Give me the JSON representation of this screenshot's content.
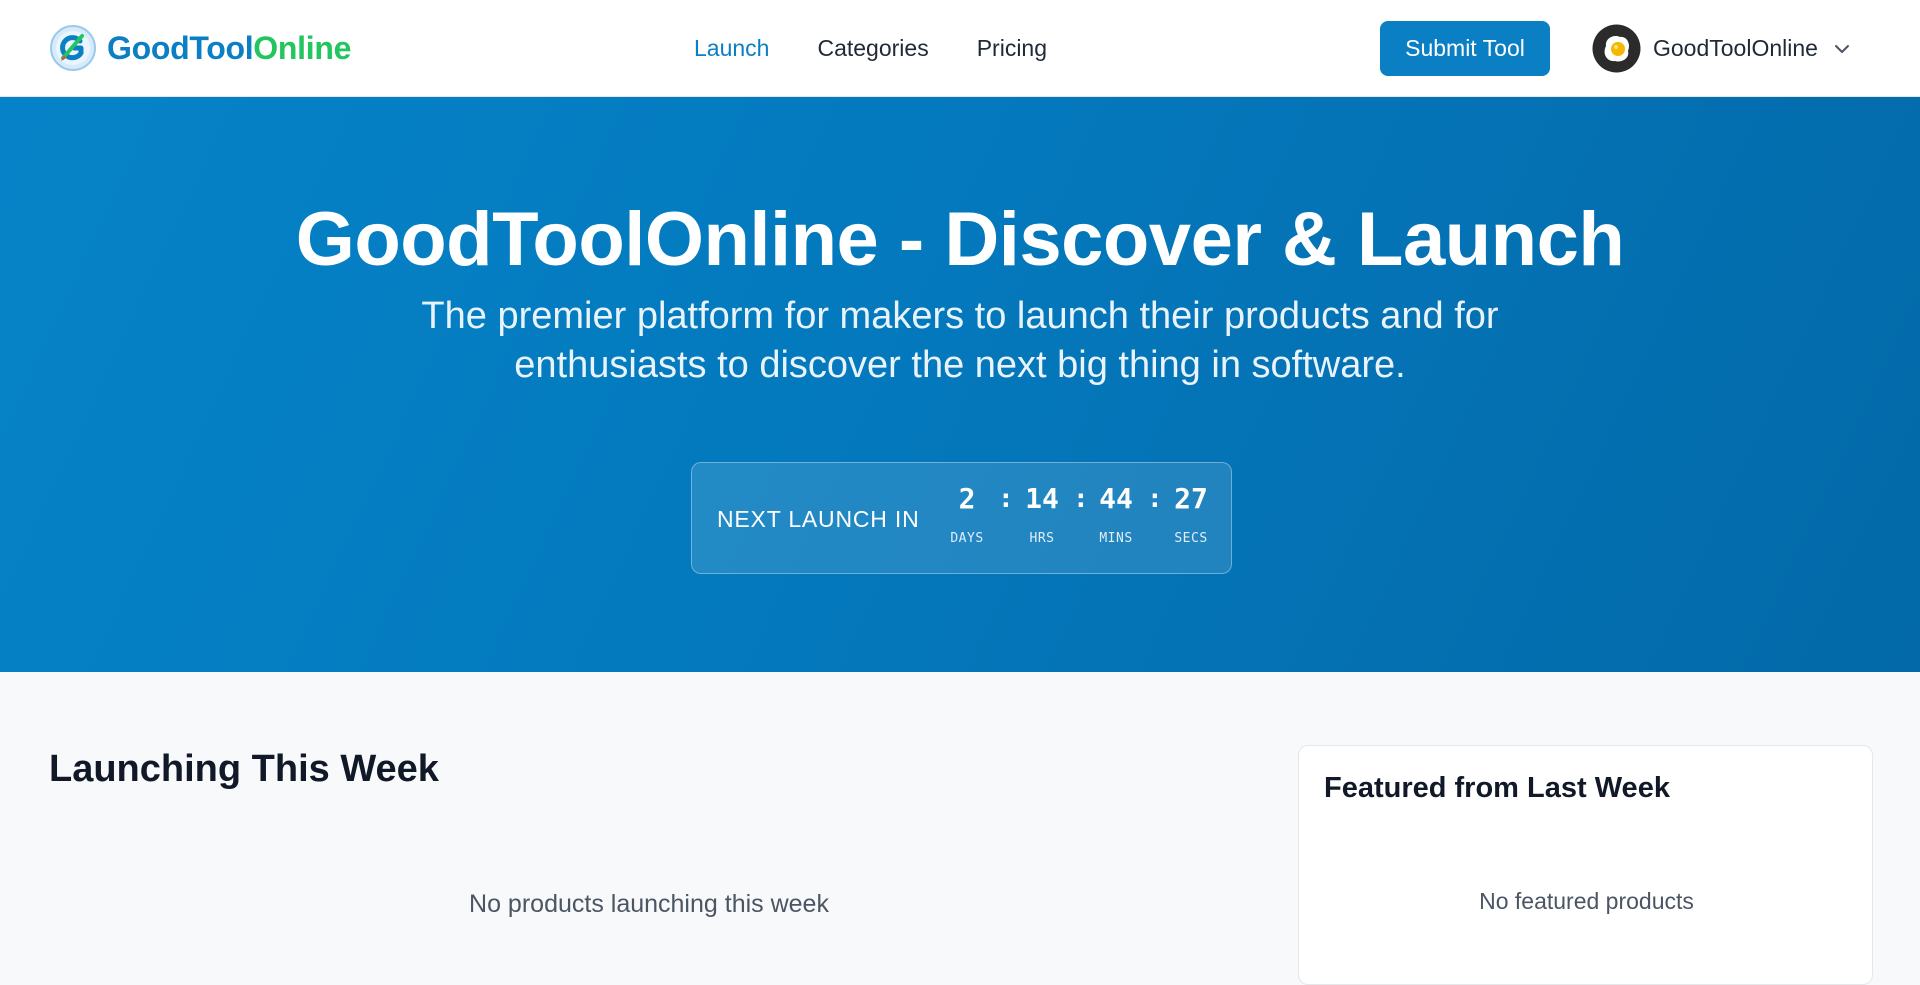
{
  "header": {
    "logo": {
      "part1": "GoodTool",
      "part2": "Online",
      "color_primary": "#0a7fc4",
      "color_accent": "#22c55e",
      "icon": "logo-icon"
    },
    "nav": {
      "launch": "Launch",
      "categories": "Categories",
      "pricing": "Pricing",
      "active": "Launch"
    },
    "submit_label": "Submit Tool",
    "user": {
      "name": "GoodToolOnline",
      "avatar_icon": "egg-avatar-icon",
      "dropdown_icon": "chevron-down-icon"
    }
  },
  "hero": {
    "title": "GoodToolOnline - Discover & Launch",
    "subtitle": "The premier platform for makers to launch their products and for enthusiasts to discover the next big thing in software.",
    "countdown": {
      "label": "NEXT LAUNCH IN",
      "days": "2",
      "days_label": "DAYS",
      "hours": "14",
      "hours_label": "HRS",
      "minutes": "44",
      "minutes_label": "MINS",
      "seconds": "27",
      "seconds_label": "SECS",
      "separator": ":"
    },
    "background_color": "#0479bd"
  },
  "main": {
    "launching_title": "Launching This Week",
    "launching_empty": "No products launching this week"
  },
  "featured": {
    "title": "Featured from Last Week",
    "empty": "No featured products"
  }
}
